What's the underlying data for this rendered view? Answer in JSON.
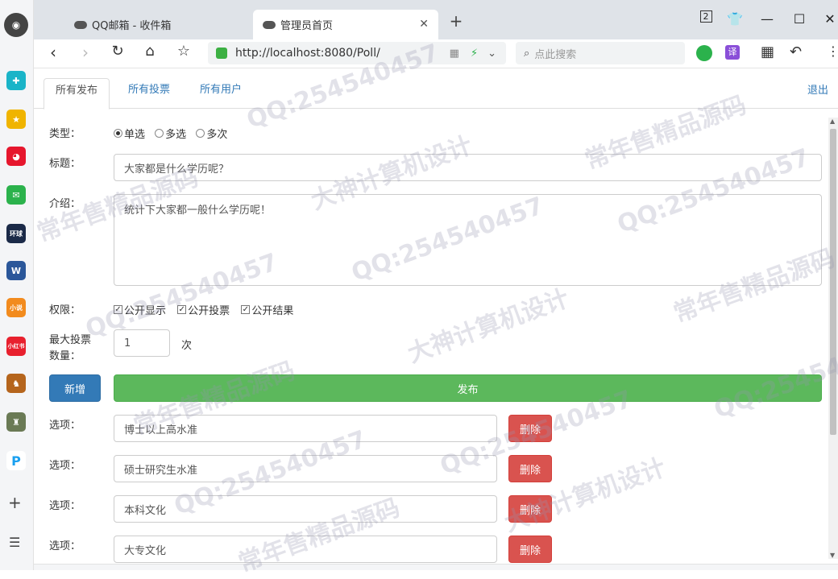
{
  "browser": {
    "tabs": [
      {
        "label": "QQ邮箱 - 收件箱",
        "active": false
      },
      {
        "label": "管理员首页",
        "active": true
      }
    ],
    "tab_count": "2",
    "url": "http://localhost:8080/Poll/",
    "search_placeholder": "点此搜索",
    "translate_badge": "译"
  },
  "dock_icons": [
    "compass-icon",
    "plus-app-icon",
    "star-app-icon",
    "weibo-icon",
    "mail-icon",
    "news-app-icon",
    "word-icon",
    "novel-app-icon",
    "xiaohongshu-icon",
    "game-app-icon",
    "game2-app-icon",
    "p-app-icon",
    "add-icon",
    "menu-icon"
  ],
  "page_nav": {
    "tabs": [
      "所有发布",
      "所有投票",
      "所有用户"
    ],
    "logout": "退出"
  },
  "form": {
    "type_label": "类型：",
    "type_options": [
      "单选",
      "多选",
      "多次"
    ],
    "type_selected": "单选",
    "title_label": "标题：",
    "title_value": "大家都是什么学历呢？",
    "intro_label": "介绍：",
    "intro_value": "统计下大家都一般什么学历呢！",
    "perm_label": "权限：",
    "permissions": [
      "公开显示",
      "公开投票",
      "公开结果"
    ],
    "max_label_1": "最大投票",
    "max_label_2": "数量：",
    "max_value": "1",
    "max_unit": "次",
    "add_button": "新增",
    "publish_button": "发布",
    "option_label": "选项：",
    "delete_button": "删除",
    "options": [
      "博士以上高水准",
      "硕士研究生水准",
      "本科文化",
      "大专文化"
    ]
  },
  "watermarks": [
    "QQ:254540457",
    "常年售精品源码",
    "大神计算机设计"
  ]
}
